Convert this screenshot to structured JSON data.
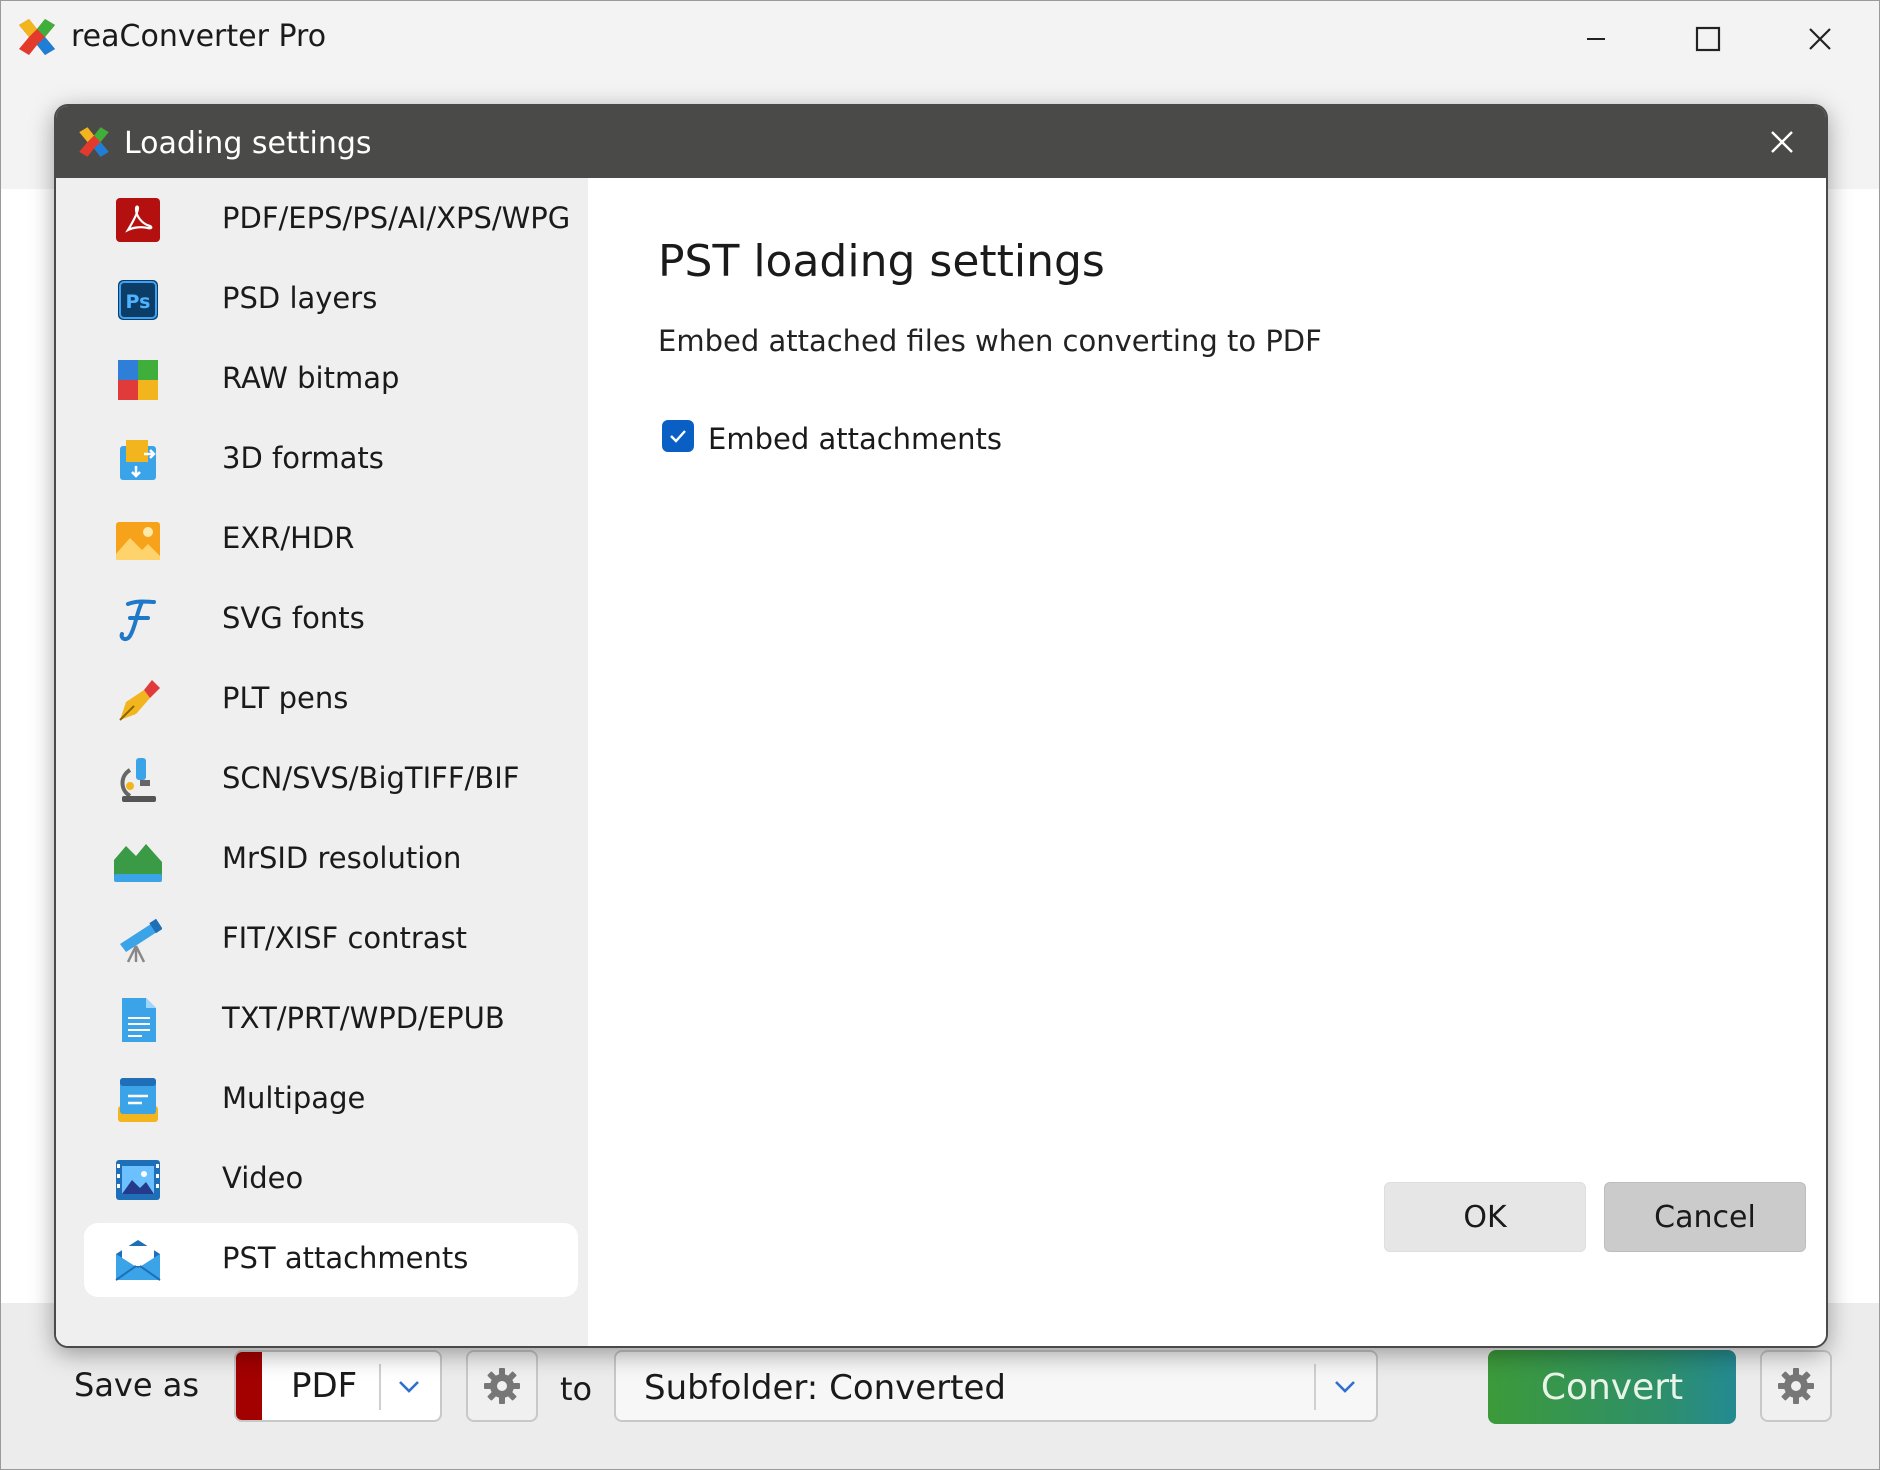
{
  "app": {
    "title": "reaConverter Pro"
  },
  "dialog": {
    "title": "Loading settings",
    "nav": [
      {
        "label": "PDF/EPS/PS/AI/XPS/WPG",
        "icon": "pdf-icon"
      },
      {
        "label": "PSD layers",
        "icon": "photoshop-icon"
      },
      {
        "label": "RAW bitmap",
        "icon": "raw-bitmap-icon"
      },
      {
        "label": "3D formats",
        "icon": "3d-cube-icon"
      },
      {
        "label": "EXR/HDR",
        "icon": "image-sun-icon"
      },
      {
        "label": "SVG fonts",
        "icon": "font-icon"
      },
      {
        "label": "PLT pens",
        "icon": "pen-icon"
      },
      {
        "label": "SCN/SVS/BigTIFF/BIF",
        "icon": "microscope-icon"
      },
      {
        "label": "MrSID resolution",
        "icon": "landscape-icon"
      },
      {
        "label": "FIT/XISF contrast",
        "icon": "telescope-icon"
      },
      {
        "label": "TXT/PRT/WPD/EPUB",
        "icon": "text-document-icon"
      },
      {
        "label": "Multipage",
        "icon": "stack-icon"
      },
      {
        "label": "Video",
        "icon": "film-icon"
      },
      {
        "label": "PST attachments",
        "icon": "envelope-icon",
        "active": true
      }
    ],
    "content": {
      "title": "PST loading settings",
      "description": "Embed attached files when converting to PDF",
      "checkbox_label": "Embed attachments",
      "checkbox_checked": true
    },
    "ok_label": "OK",
    "cancel_label": "Cancel"
  },
  "bottombar": {
    "save_as_label": "Save as",
    "format": "PDF",
    "to_label": "to",
    "destination": "Subfolder: Converted",
    "convert_label": "Convert"
  },
  "colors": {
    "checkbox": "#0a5fc4",
    "dialog_titlebar": "#4a4a48",
    "format_swatch": "#a30000",
    "convert_start": "#3c9a3a",
    "convert_end": "#248a92"
  }
}
